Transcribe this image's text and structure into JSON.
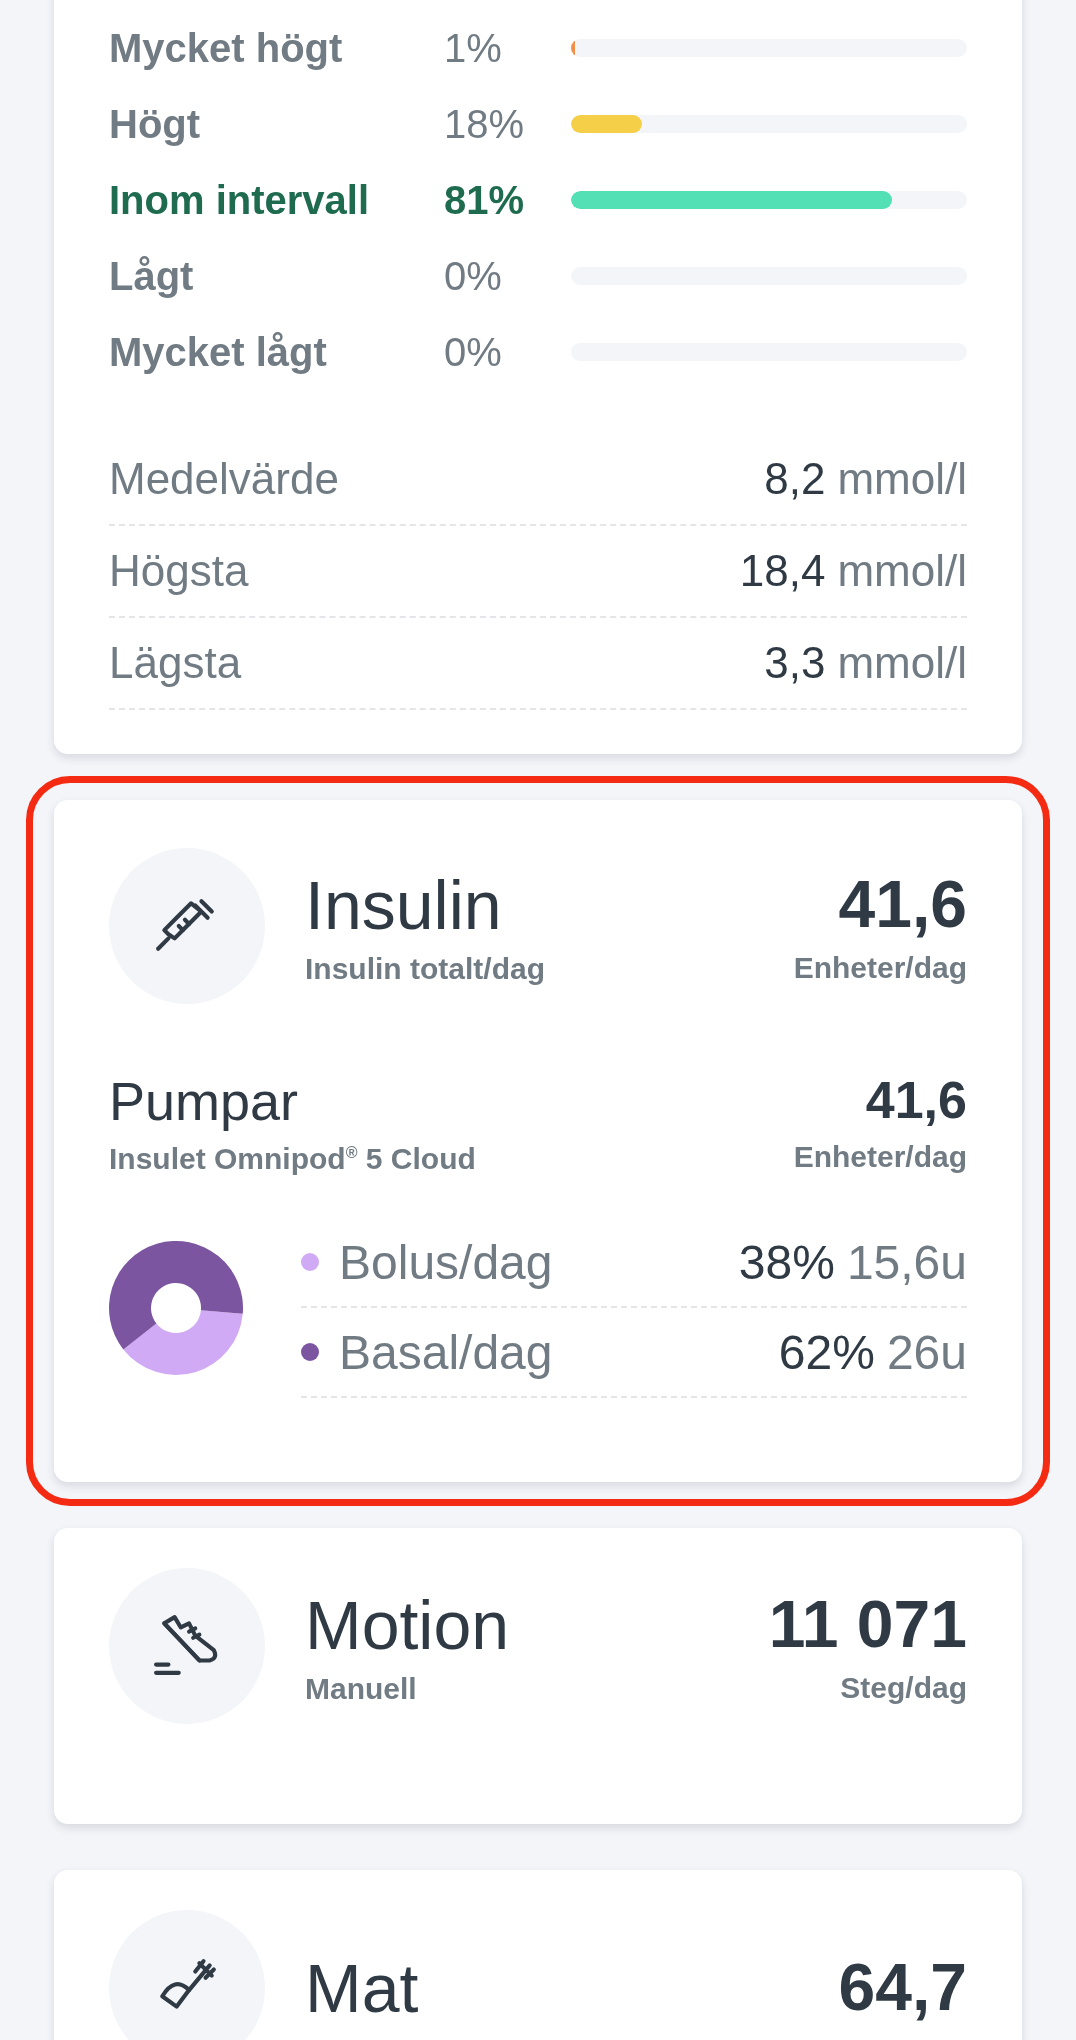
{
  "ranges": [
    {
      "label": "Mycket högt",
      "value": "1%",
      "level": 0.01,
      "color": "#f0914a",
      "emphasized": false
    },
    {
      "label": "Högt",
      "value": "18%",
      "level": 0.18,
      "color": "#f5cf47",
      "emphasized": false
    },
    {
      "label": "Inom intervall",
      "value": "81%",
      "level": 0.81,
      "color": "#52e0b4",
      "emphasized": true
    },
    {
      "label": "Lågt",
      "value": "0%",
      "emphasized": false
    },
    {
      "label": "Mycket lågt",
      "value": "0%",
      "emphasized": false
    }
  ],
  "stats": [
    {
      "label": "Medelvärde",
      "value": "8,2",
      "unit": "mmol/l"
    },
    {
      "label": "Högsta",
      "value": "18,4",
      "unit": "mmol/l"
    },
    {
      "label": "Lägsta",
      "value": "3,3",
      "unit": "mmol/l"
    }
  ],
  "cards": [
    {
      "kind": "insulin",
      "highlighted": true,
      "title": "Insulin",
      "subtitle": "Insulin totalt/dag",
      "value": "41,6",
      "unit": "Enheter/dag",
      "pump": {
        "title": "Pumpar",
        "device": "Insulet Omnipod$^{®}$ 5 Cloud",
        "value": "41,6",
        "unit": "Enheter/dag",
        "chart_data": {
          "type": "donut",
          "categories": [
            "Bolus/dag",
            "Basal/dag"
          ],
          "values": [
            38,
            62
          ]
        },
        "legend": [
          {
            "color": "#d0aaf5",
            "percent": "38%",
            "amount": "15,6u"
          },
          {
            "color": "#7b55a0",
            "percent": "62%",
            "amount": "26u"
          }
        ]
      }
    },
    {
      "kind": "exercise",
      "highlighted": false,
      "title": "Motion",
      "subtitle": "Manuell",
      "value": "11 071",
      "unit": "Steg/dag"
    },
    {
      "kind": "food",
      "highlighted": false,
      "title": "Mat",
      "value": "64,7"
    }
  ]
}
